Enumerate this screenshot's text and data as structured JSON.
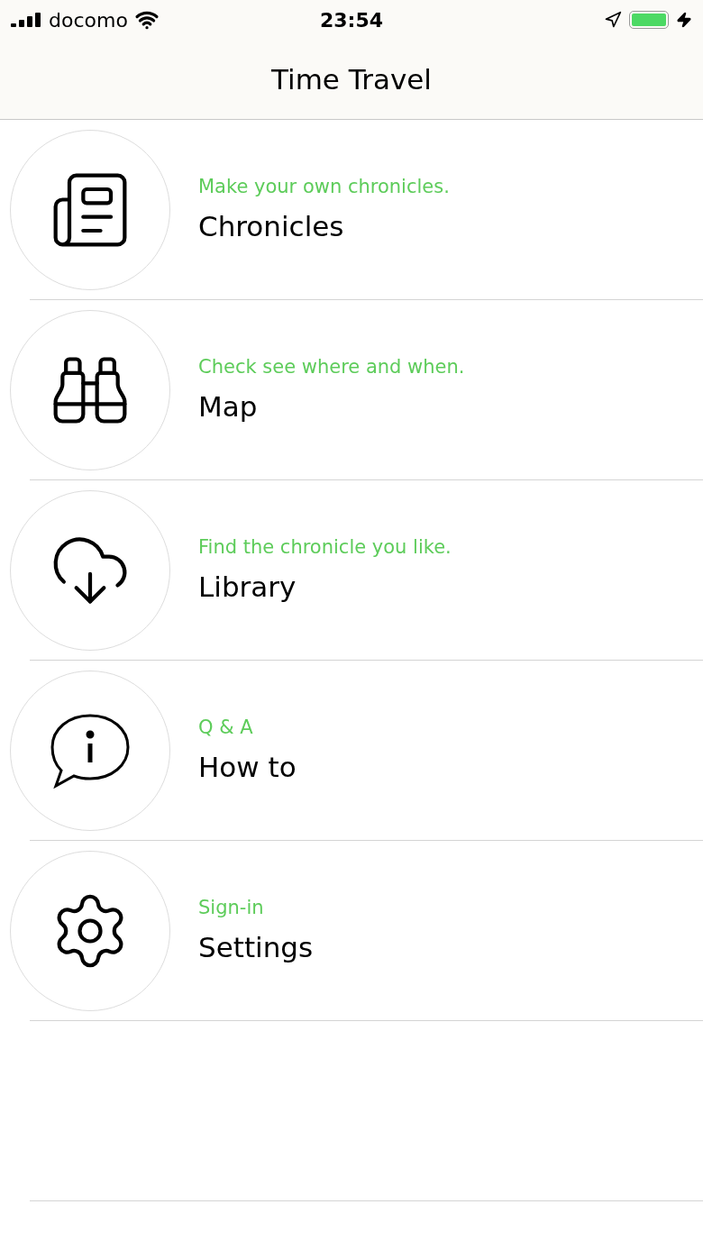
{
  "status_bar": {
    "carrier": "docomo",
    "time": "23:54"
  },
  "nav": {
    "title": "Time Travel"
  },
  "items": [
    {
      "kind": "newspaper",
      "subtitle": "Make your own chronicles.",
      "title": "Chronicles"
    },
    {
      "kind": "binoculars",
      "subtitle": "Check see where and when.",
      "title": "Map"
    },
    {
      "kind": "cloud",
      "subtitle": "Find the chronicle you like.",
      "title": "Library"
    },
    {
      "kind": "info",
      "subtitle": "Q & A",
      "title": "How to"
    },
    {
      "kind": "gear",
      "subtitle": "Sign-in",
      "title": "Settings"
    }
  ]
}
